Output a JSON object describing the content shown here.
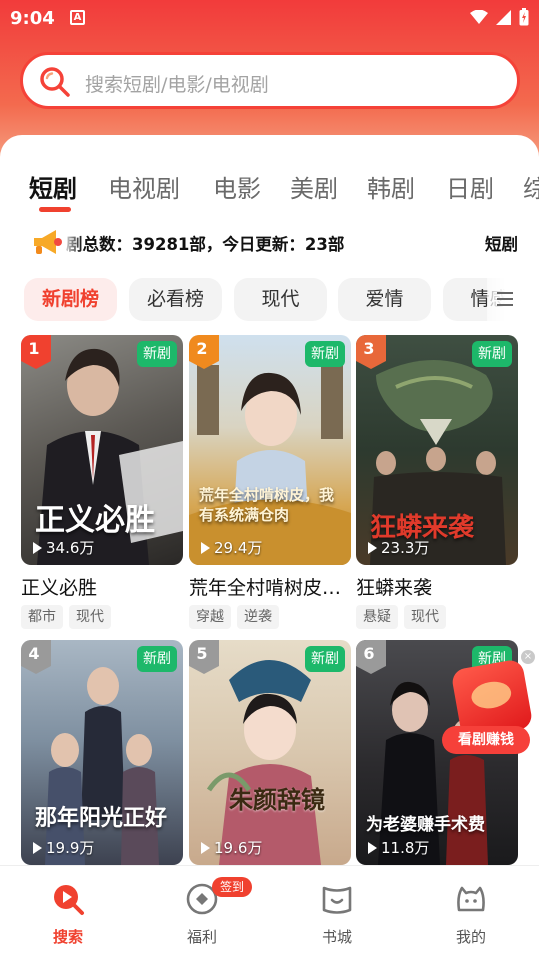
{
  "status_bar": {
    "time": "9:04",
    "notification_glyph": "A"
  },
  "search": {
    "placeholder": "搜索短剧/电影/电视剧"
  },
  "tabs": [
    "短剧",
    "电视剧",
    "电影",
    "美剧",
    "韩剧",
    "日剧",
    "综"
  ],
  "active_tab": "短剧",
  "notice": {
    "text": "剧总数：39281部，今日更新：23部",
    "text_next": "短剧"
  },
  "filter_chips": [
    "新剧榜",
    "必看榜",
    "现代",
    "爱情",
    "情感"
  ],
  "active_chip": "新剧榜",
  "new_badge": "新剧",
  "dramas": [
    {
      "rank": "1",
      "title": "正义必胜",
      "poster_title": "正义必胜",
      "views": "34.6万",
      "tags": [
        "都市",
        "现代"
      ]
    },
    {
      "rank": "2",
      "title": "荒年全村啃树皮，我有系统满仓肉",
      "poster_title": "荒年全村啃树皮，我有系统满仓肉",
      "views": "29.4万",
      "tags": [
        "穿越",
        "逆袭"
      ]
    },
    {
      "rank": "3",
      "title": "狂蟒来袭",
      "poster_title": "狂蟒来袭",
      "views": "23.3万",
      "tags": [
        "悬疑",
        "现代"
      ]
    },
    {
      "rank": "4",
      "title": "",
      "poster_title": "那年阳光正好",
      "views": "19.9万",
      "tags": []
    },
    {
      "rank": "5",
      "title": "",
      "poster_title": "朱颜辞镜",
      "views": "19.6万",
      "tags": []
    },
    {
      "rank": "6",
      "title": "",
      "poster_title": "为老婆赚手术费",
      "views": "11.8万",
      "tags": []
    }
  ],
  "floating_promo": {
    "label": "看剧赚钱",
    "close": "×"
  },
  "bottom_nav": [
    {
      "label": "搜索",
      "icon": "search-play-icon"
    },
    {
      "label": "福利",
      "icon": "welfare-coin-icon"
    },
    {
      "label": "书城",
      "icon": "book-icon"
    },
    {
      "label": "我的",
      "icon": "profile-face-icon"
    }
  ],
  "sign_badge": "签到",
  "colors": {
    "accent": "#f0412f",
    "new_badge": "#1db86a",
    "hero_top": "#f23b3b"
  }
}
